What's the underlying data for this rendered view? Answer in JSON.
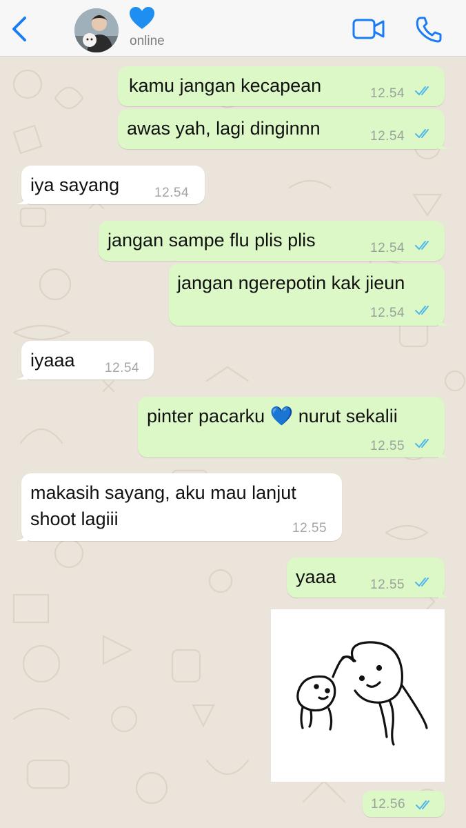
{
  "header": {
    "contact_name": "💙",
    "status": "online",
    "icons": {
      "back": "chevron-left-icon",
      "video": "video-call-icon",
      "call": "phone-icon"
    },
    "accent_color": "#1a7cf5"
  },
  "messages": [
    {
      "dir": "out",
      "text": "kamu jangan kecapean",
      "time": "12.54"
    },
    {
      "dir": "out",
      "text": "awas yah, lagi dinginnn",
      "time": "12.54"
    },
    {
      "dir": "in",
      "text": "iya sayang",
      "time": "12.54"
    },
    {
      "dir": "out",
      "text": "jangan sampe flu plis plis",
      "time": "12.54"
    },
    {
      "dir": "out",
      "text": "jangan ngerepotin kak jieun",
      "time": "12.54"
    },
    {
      "dir": "in",
      "text": "iyaaa",
      "time": "12.54"
    },
    {
      "dir": "out",
      "text": "pinter pacarku 💙 nurut sekalii",
      "time": "12.55"
    },
    {
      "dir": "in",
      "text_line1": "makasih sayang, aku mau lanjut",
      "text_line2": "shoot lagiii",
      "time": "12.55"
    },
    {
      "dir": "out",
      "text": "yaaa",
      "time": "12.55"
    },
    {
      "dir": "out",
      "type": "sticker",
      "sticker": "hug-sticker",
      "time": "12.56"
    }
  ],
  "colors": {
    "outgoing": "#dcf8c6",
    "incoming": "#ffffff",
    "read_ticks": "#4fb6ec",
    "background": "#ebe4da"
  }
}
